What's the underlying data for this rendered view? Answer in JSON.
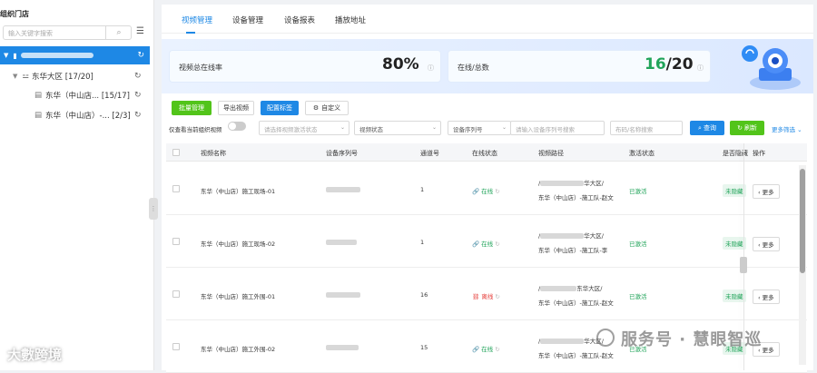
{
  "sidebar": {
    "title": "组织门店",
    "search_placeholder": "输入关键字搜索",
    "tree": [
      {
        "label": "东华大区 [17/20]"
      },
      {
        "label": "东华（中山店... [15/17]"
      },
      {
        "label": "东华（中山店）-... [2/3]"
      }
    ]
  },
  "tabs": [
    "视频管理",
    "设备管理",
    "设备报表",
    "播放地址"
  ],
  "stats": {
    "online_rate_label": "视频总在线率",
    "online_rate_value": "80%",
    "online_total_label": "在线/总数",
    "online_count": "16",
    "total_count": "/20"
  },
  "toolbar": {
    "batch_manage": "批量管理",
    "export_video": "导出视频",
    "configure_tags": "配置标签",
    "customize": "自定义"
  },
  "filters": {
    "current_org_only": "仅查看当前组织视频",
    "activation_status": "请选择视频激活状态",
    "video_status": "视频状态",
    "serial_no": "设备序列号",
    "serial_placeholder": "请输入设备序列号搜索",
    "channel_placeholder": "布码/名称搜索",
    "search": "查询",
    "refresh": "刷新",
    "more_filters": "更多筛选"
  },
  "table": {
    "headers": [
      "视频名称",
      "设备序列号",
      "通道号",
      "在线状态",
      "视频路径",
      "激活状态",
      "是否隐藏",
      "操作"
    ],
    "rows": [
      {
        "name": "东华（中山店）施工现场-01",
        "channel": "1",
        "status": "在线",
        "path1": "/",
        "path1b": "华大区/",
        "path2": "东华（中山店）-施工队-赵文",
        "activation": "已激活",
        "hidden": "未隐藏",
        "action": "更多"
      },
      {
        "name": "东华（中山店）施工现场-02",
        "channel": "1",
        "status": "在线",
        "path1": "/",
        "path1b": "华大区/",
        "path2": "东华（中山店）-施工队-李",
        "activation": "已激活",
        "hidden": "未隐藏",
        "action": "更多"
      },
      {
        "name": "东华（中山店）施工外围-01",
        "channel": "16",
        "status": "离线",
        "path1": "/",
        "path1b": "东华大区/",
        "path2": "东华（中山店）-施工队-赵文",
        "activation": "已激活",
        "hidden": "未隐藏",
        "action": "更多"
      },
      {
        "name": "东华（中山店）施工外围-02",
        "channel": "15",
        "status": "在线",
        "path1": "/",
        "path1b": "华大区/",
        "path2": "东华（中山店）-施工队-赵文",
        "activation": "已激活",
        "hidden": "未隐藏",
        "action": "更多"
      }
    ]
  },
  "watermarks": {
    "bottom_left": "大數跨境",
    "bottom_right": "服务号 · 慧眼智巡"
  },
  "colors": {
    "accent": "#1e88e5",
    "success": "#21a45a",
    "danger": "#e53935",
    "green_button": "#52c41a"
  }
}
